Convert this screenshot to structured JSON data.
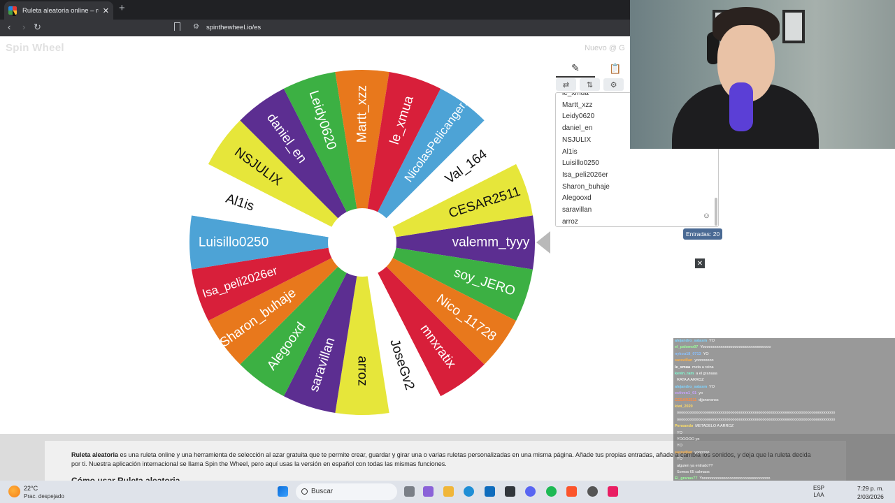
{
  "browser": {
    "tab_title": "Ruleta aleatoria online – ruleta d",
    "tab_close": "✕",
    "new_tab": "+",
    "url": "spinthewheel.io/es",
    "back": "‹",
    "forward": "›",
    "reload": "↻"
  },
  "site": {
    "logo": "Spin Wheel",
    "top_links": "Nuevo   @ G"
  },
  "wheel": {
    "colors": {
      "green": "#3cb043",
      "orange": "#e8781c",
      "red": "#d81f3a",
      "blue": "#4da3d6",
      "white": "#ffffff",
      "yellow": "#e6e63a",
      "purple": "#5c2e91"
    },
    "slices": [
      {
        "label": "valemm_tyyy",
        "color": "purple"
      },
      {
        "label": "soy_JERO",
        "color": "green"
      },
      {
        "label": "Nico_11728",
        "color": "orange"
      },
      {
        "label": "mnxratix",
        "color": "red"
      },
      {
        "label": "JoseGv2",
        "color": "white"
      },
      {
        "label": "arroz",
        "color": "yellow"
      },
      {
        "label": "saravillan",
        "color": "purple"
      },
      {
        "label": "Alegooxd",
        "color": "green"
      },
      {
        "label": "Sharon_buhaje",
        "color": "orange"
      },
      {
        "label": "Isa_peli2026er",
        "color": "red"
      },
      {
        "label": "Luisillo0250",
        "color": "blue"
      },
      {
        "label": "Al1is",
        "color": "white"
      },
      {
        "label": "NSJULIX",
        "color": "yellow"
      },
      {
        "label": "daniel_en",
        "color": "purple"
      },
      {
        "label": "Leidy0620",
        "color": "green"
      },
      {
        "label": "Martt_xzz",
        "color": "orange"
      },
      {
        "label": "le_xmua",
        "color": "red"
      },
      {
        "label": "NicolasPelicanger...",
        "color": "blue"
      },
      {
        "label": "Val_164",
        "color": "white"
      },
      {
        "label": "CESAR2511",
        "color": "yellow"
      }
    ]
  },
  "panel": {
    "edit_icon": "✎",
    "clipboard_icon": "📋",
    "tools": [
      "⇄",
      "⇅",
      "⚙",
      "A"
    ],
    "entries": [
      "le_xmua",
      "Martt_xzz",
      "Leidy0620",
      "daniel_en",
      "NSJULIX",
      "Al1is",
      "Luisillo0250",
      "Isa_peli2026er",
      "Sharon_buhaje",
      "Alegooxd",
      "saravillan",
      "arroz"
    ],
    "emoji": "☺",
    "count": "Entradas: 20",
    "close": "✕"
  },
  "article": {
    "bold_lead": "Ruleta aleatoria",
    "text": " es una ruleta online y una herramienta de selección al azar gratuita que te permite crear, guardar y girar una o varias ruletas personalizadas en una misma página. Añade tus propias entradas, añade a cambia los sonidos, y deja que la ruleta decida por ti. Nuestra aplicación internacional se llama Spin the Wheel, pero aquí usas la versión en español con todas las mismas funciones.",
    "heading": "Cómo usar Ruleta aleatoria"
  },
  "chat": {
    "lines": [
      {
        "name": "alejandro_salasm",
        "msg": "YO",
        "color": "#7fd4ff"
      },
      {
        "name": "el_palomo07",
        "msg": "Yoooooooooooooooooooooooooooooooo",
        "color": "#9bff9b"
      },
      {
        "name": "nykou18_0713",
        "msg": "YO",
        "color": "#88c0ff"
      },
      {
        "name": "saravillan",
        "msg": "yoooooooo",
        "color": "#ffb347"
      },
      {
        "name": "le_xmua",
        "msg": "meta a reina",
        "color": "#ffffff"
      },
      {
        "name": "kevin_ram",
        "msg": "a el granaaa",
        "color": "#7fffd4"
      },
      {
        "name": "",
        "msg": "RATA A ARROZ",
        "color": "#ff6b6b"
      },
      {
        "name": "alejandro_salasm",
        "msg": "YO",
        "color": "#7fd4ff"
      },
      {
        "name": "estiven1_01",
        "msg": "yo",
        "color": "#c8a2ff"
      },
      {
        "name": "CESAR2511",
        "msg": "djjsnsnsnss",
        "color": "#ff8c42"
      },
      {
        "name": "kiwi_2020",
        "msg": "",
        "color": "#ffd966"
      },
      {
        "name": "",
        "msg": "oooooooooooooooooooooooooooooooooooooooooooooooooooooooooooooooooooooooooo",
        "color": "#ffffff"
      },
      {
        "name": "",
        "msg": "oooooooooooooooooooooooooooooooooooooooooooooooooooooooooooooooooooooooooo",
        "color": "#ffffff"
      },
      {
        "name": "Pensando",
        "msg": "METADELO A ARROZ",
        "color": "#ffe066"
      },
      {
        "name": "",
        "msg": "YO",
        "color": "#ff9ff3"
      },
      {
        "name": "",
        "msg": "YOOOOO yo",
        "color": "#9bff9b"
      },
      {
        "name": "",
        "msg": "YO",
        "color": "#7fd4ff"
      },
      {
        "name": "saravillan",
        "msg": "yoooooo",
        "color": "#ffb347"
      },
      {
        "name": "",
        "msg": "YO",
        "color": "#c8a2ff"
      },
      {
        "name": "",
        "msg": "alguien ya entrado??",
        "color": "#ffffff"
      },
      {
        "name": "",
        "msg": "Somos 65 calmaos",
        "color": "#ff6b6b"
      },
      {
        "name": "El_granas77",
        "msg": "Yoooooooooooooooooooooooooooooooo",
        "color": "#9bff9b"
      },
      {
        "name": "aleuc1_01",
        "msg": "yo",
        "color": "#7fd4ff"
      }
    ]
  },
  "taskbar": {
    "temp": "22°C",
    "weather": "Prac. despejado",
    "search": "Buscar",
    "lang": "ESP",
    "region": "LAA",
    "time": "7:29 p. m.",
    "date": "2/03/2026"
  }
}
